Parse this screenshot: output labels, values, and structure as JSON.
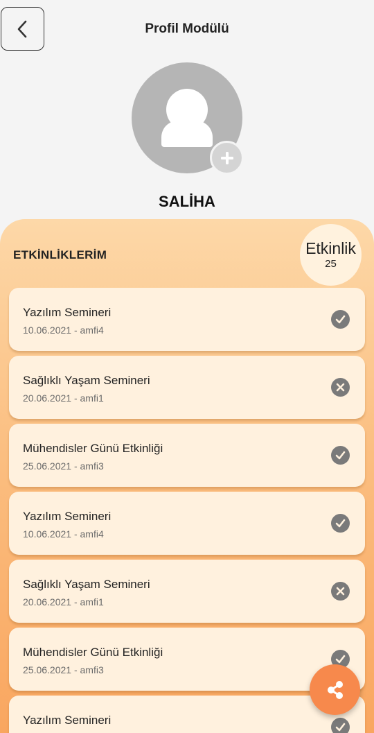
{
  "header": {
    "title": "Profil Modülü",
    "back_icon": "chevron-left-icon"
  },
  "profile": {
    "avatar_icon": "person-icon",
    "add_photo_icon": "plus-icon",
    "name": "SALİHA"
  },
  "events_section": {
    "title": "ETKİNLİKLERİM",
    "count_label": "Etkinlik",
    "count_value": "25"
  },
  "events": [
    {
      "title": "Yazılım Semineri",
      "subtitle": "10.06.2021 - amfi4",
      "status": "check"
    },
    {
      "title": "Sağlıklı Yaşam Semineri",
      "subtitle": "20.06.2021 - amfi1",
      "status": "cross"
    },
    {
      "title": "Mühendisler Günü Etkinliği",
      "subtitle": "25.06.2021 - amfi3",
      "status": "check"
    },
    {
      "title": "Yazılım Semineri",
      "subtitle": "10.06.2021 - amfi4",
      "status": "check"
    },
    {
      "title": "Sağlıklı Yaşam Semineri",
      "subtitle": "20.06.2021 - amfi1",
      "status": "cross"
    },
    {
      "title": "Mühendisler Günü Etkinliği",
      "subtitle": "25.06.2021 - amfi3",
      "status": "check"
    },
    {
      "title": "Yazılım Semineri",
      "subtitle": "",
      "status": "check"
    }
  ],
  "fab": {
    "icon": "share-icon"
  },
  "colors": {
    "accent": "#f7894c",
    "card_background": "#fff1de",
    "panel_top": "#fdd8a8",
    "panel_bottom": "#f9a55e",
    "status_icon": "#7a7a7a"
  }
}
